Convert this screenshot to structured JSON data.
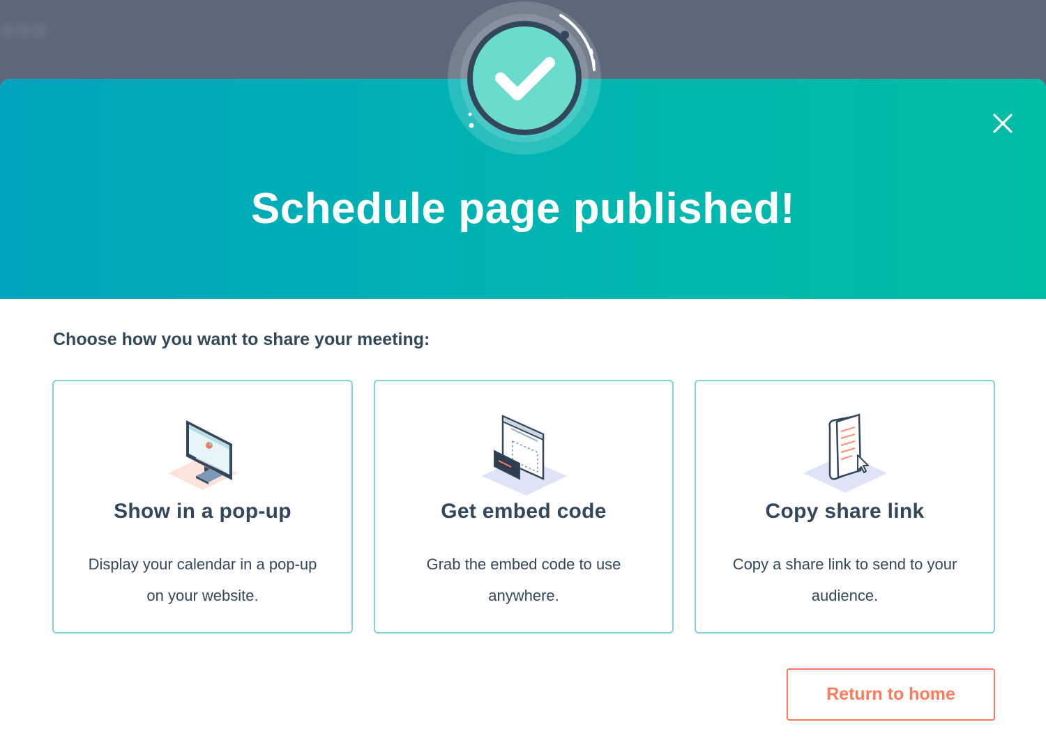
{
  "modal": {
    "title": "Schedule page published!",
    "prompt": "Choose how you want to share your meeting:",
    "close_icon": "close-icon",
    "badge_icon": "checkmark-circle-icon"
  },
  "options": [
    {
      "title": "Show in a pop-up",
      "description": "Display your calendar in a pop-up on your website.",
      "icon": "monitor-illustration"
    },
    {
      "title": "Get embed code",
      "description": "Grab the embed code to use anywhere.",
      "icon": "embed-code-illustration"
    },
    {
      "title": "Copy share link",
      "description": "Copy a share link to send to your audience.",
      "icon": "share-link-illustration"
    }
  ],
  "actions": {
    "return_label": "Return to home"
  },
  "colors": {
    "header_start": "#00a4bd",
    "header_end": "#00bda5",
    "card_border": "#7fd1de",
    "text": "#33475b",
    "accent": "#ff7a59",
    "backdrop": "#5c6779"
  }
}
